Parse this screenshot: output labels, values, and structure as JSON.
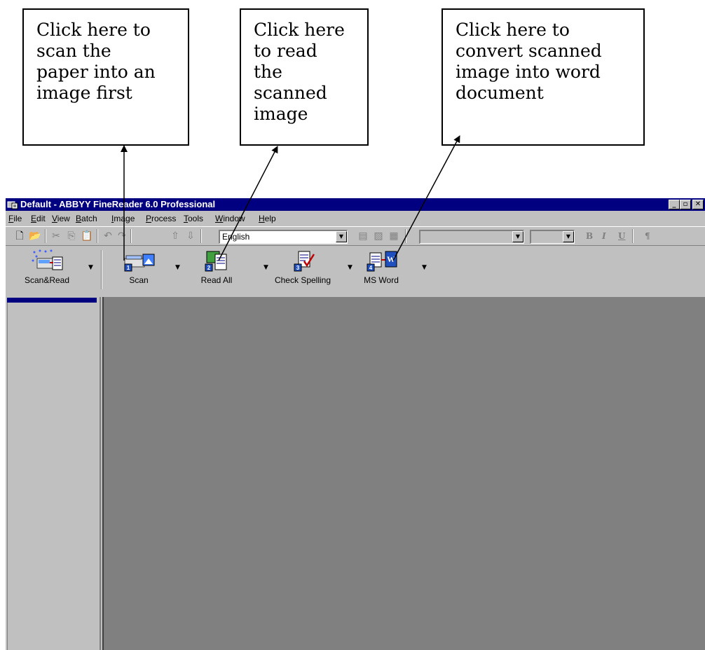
{
  "callouts": [
    {
      "text": "Click here to\nscan the\npaper into an\nimage first"
    },
    {
      "text": "Click here\nto read\nthe\nscanned\nimage"
    },
    {
      "text": "Click here to\nconvert scanned\nimage into word\ndocument"
    }
  ],
  "window": {
    "title": "Default - ABBYY FineReader 6.0 Professional",
    "minimize": "_",
    "restore": "▫",
    "close": "✕"
  },
  "menubar": {
    "items": [
      {
        "label": "File",
        "key": "F"
      },
      {
        "label": "Edit",
        "key": "E"
      },
      {
        "label": "View",
        "key": "V"
      },
      {
        "label": "Batch",
        "key": "B"
      },
      {
        "label": "Image",
        "key": "I"
      },
      {
        "label": "Process",
        "key": "P"
      },
      {
        "label": "Tools",
        "key": "T"
      },
      {
        "label": "Window",
        "key": "W"
      },
      {
        "label": "Help",
        "key": "H"
      }
    ]
  },
  "toolbar": {
    "language": "English",
    "bold": "B",
    "italic": "I",
    "underline": "U",
    "pilcrow": "¶"
  },
  "big_toolbar": {
    "scan_read": "Scan&Read",
    "scan": "Scan",
    "read_all": "Read All",
    "check_spelling": "Check Spelling",
    "ms_word": "MS Word",
    "dropdown": "▼"
  }
}
